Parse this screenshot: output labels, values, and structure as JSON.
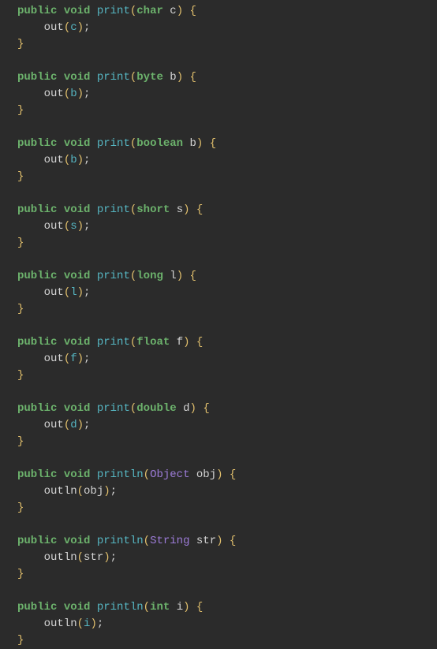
{
  "methods": [
    {
      "access": "public",
      "returnType": "void",
      "name": "print",
      "paramType": "char",
      "paramTypeKind": "prim",
      "paramName": "c",
      "bodyCall": "out",
      "bodyArg": "c",
      "argStyle": "colored"
    },
    {
      "access": "public",
      "returnType": "void",
      "name": "print",
      "paramType": "byte",
      "paramTypeKind": "prim",
      "paramName": "b",
      "bodyCall": "out",
      "bodyArg": "b",
      "argStyle": "colored"
    },
    {
      "access": "public",
      "returnType": "void",
      "name": "print",
      "paramType": "boolean",
      "paramTypeKind": "prim",
      "paramName": "b",
      "bodyCall": "out",
      "bodyArg": "b",
      "argStyle": "colored"
    },
    {
      "access": "public",
      "returnType": "void",
      "name": "print",
      "paramType": "short",
      "paramTypeKind": "prim",
      "paramName": "s",
      "bodyCall": "out",
      "bodyArg": "s",
      "argStyle": "colored"
    },
    {
      "access": "public",
      "returnType": "void",
      "name": "print",
      "paramType": "long",
      "paramTypeKind": "prim",
      "paramName": "l",
      "bodyCall": "out",
      "bodyArg": "l",
      "argStyle": "colored"
    },
    {
      "access": "public",
      "returnType": "void",
      "name": "print",
      "paramType": "float",
      "paramTypeKind": "prim",
      "paramName": "f",
      "bodyCall": "out",
      "bodyArg": "f",
      "argStyle": "colored"
    },
    {
      "access": "public",
      "returnType": "void",
      "name": "print",
      "paramType": "double",
      "paramTypeKind": "prim",
      "paramName": "d",
      "bodyCall": "out",
      "bodyArg": "d",
      "argStyle": "colored"
    },
    {
      "access": "public",
      "returnType": "void",
      "name": "println",
      "paramType": "Object",
      "paramTypeKind": "obj",
      "paramName": "obj",
      "bodyCall": "outln",
      "bodyArg": "obj",
      "argStyle": "plain"
    },
    {
      "access": "public",
      "returnType": "void",
      "name": "println",
      "paramType": "String",
      "paramTypeKind": "obj",
      "paramName": "str",
      "bodyCall": "outln",
      "bodyArg": "str",
      "argStyle": "plain"
    },
    {
      "access": "public",
      "returnType": "void",
      "name": "println",
      "paramType": "int",
      "paramTypeKind": "prim",
      "paramName": "i",
      "bodyCall": "outln",
      "bodyArg": "i",
      "argStyle": "colored"
    }
  ]
}
